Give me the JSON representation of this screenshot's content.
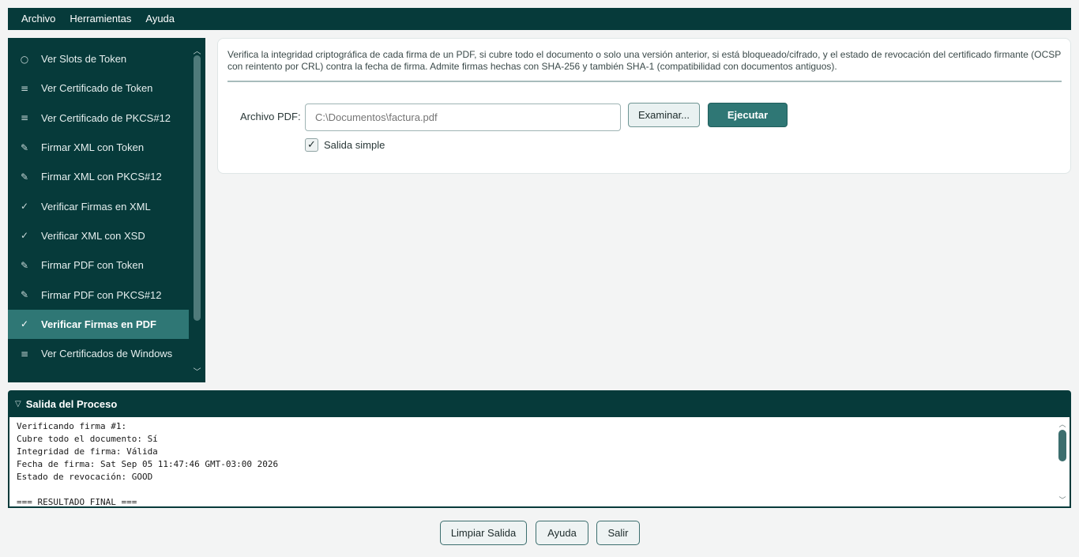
{
  "menubar": {
    "items": [
      "Archivo",
      "Herramientas",
      "Ayuda"
    ]
  },
  "sidebar": {
    "items": [
      {
        "icon": "○",
        "icon_name": "token-slots-icon",
        "label": "Ver Slots de Token"
      },
      {
        "icon": "≡",
        "icon_name": "list-icon",
        "label": "Ver Certificado de Token"
      },
      {
        "icon": "≡",
        "icon_name": "list-icon",
        "label": "Ver Certificado de PKCS#12"
      },
      {
        "icon": "✎",
        "icon_name": "sign-icon",
        "label": "Firmar XML con Token"
      },
      {
        "icon": "✎",
        "icon_name": "sign-icon",
        "label": "Firmar XML con PKCS#12"
      },
      {
        "icon": "✓",
        "icon_name": "check-icon",
        "label": "Verificar Firmas en XML"
      },
      {
        "icon": "✓",
        "icon_name": "check-icon",
        "label": "Verificar XML con XSD"
      },
      {
        "icon": "✎",
        "icon_name": "sign-icon",
        "label": "Firmar PDF con Token"
      },
      {
        "icon": "✎",
        "icon_name": "sign-icon",
        "label": "Firmar PDF con PKCS#12"
      },
      {
        "icon": "✓",
        "icon_name": "check-icon",
        "label": "Verificar Firmas en PDF"
      },
      {
        "icon": "≡",
        "icon_name": "list-icon",
        "label": "Ver Certificados de Windows"
      }
    ],
    "active_index": 9
  },
  "main": {
    "description": "Verifica la integridad criptográfica de cada firma de un PDF, si cubre todo el documento o solo una versión anterior, si está bloqueado/cifrado, y el estado de revocación del certificado firmante (OCSP con reintento por CRL) contra la fecha de firma. Admite firmas hechas con SHA-256 y también SHA-1 (compatibilidad con documentos antiguos).",
    "pdf_label": "Archivo PDF:",
    "pdf_placeholder": "C:\\Documentos\\factura.pdf",
    "browse_label": "Examinar...",
    "run_label": "Ejecutar",
    "simple_output_label": "Salida simple",
    "simple_output_checked": true
  },
  "output": {
    "title": "Salida del Proceso",
    "text": "Verificando firma #1:\nCubre todo el documento: Sí\nIntegridad de firma: Válida\nFecha de firma: Sat Sep 05 11:47:46 GMT-03:00 2026\nEstado de revocación: GOOD\n\n=== RESULTADO FINAL ==="
  },
  "footer": {
    "clear_label": "Limpiar Salida",
    "help_label": "Ayuda",
    "exit_label": "Salir"
  },
  "colors": {
    "primary_dark": "#063a3a",
    "accent": "#2f7775",
    "background": "#f3f4f4"
  }
}
